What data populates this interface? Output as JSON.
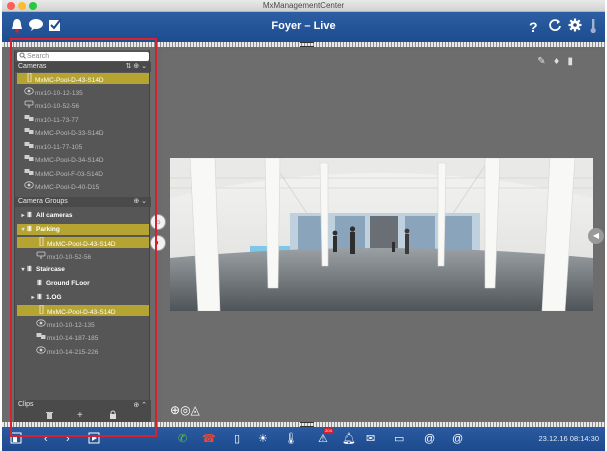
{
  "window": {
    "title": "MxManagementCenter"
  },
  "header": {
    "camera_title": "Foyer – Live",
    "help_icon": "?"
  },
  "sidebar": {
    "search_placeholder": "Search",
    "cameras_label": "Cameras",
    "cameras": [
      {
        "name": "MxMC-Pool-D-43-S14D",
        "icon": "pole-camera-icon",
        "selected": true
      },
      {
        "name": "mx10-10-12-135",
        "icon": "dome-camera-icon",
        "selected": false
      },
      {
        "name": "mx10-10-52-56",
        "icon": "bullet-camera-icon",
        "selected": false
      },
      {
        "name": "mx10-11-73-77",
        "icon": "dual-camera-icon",
        "selected": false
      },
      {
        "name": "MxMC-Pool-D-33-S14D",
        "icon": "dual-camera-icon",
        "selected": false
      },
      {
        "name": "mx10-11-77-105",
        "icon": "dual-camera-icon",
        "selected": false
      },
      {
        "name": "MxMC-Pool-D-34-S14D",
        "icon": "dual-camera-icon",
        "selected": false
      },
      {
        "name": "MxMC-Pool-F-03-S14D",
        "icon": "dual-camera-icon",
        "selected": false
      },
      {
        "name": "MxMC-Pool-D-40-D15",
        "icon": "dome-camera-icon",
        "selected": false
      }
    ],
    "groups_label": "Camera Groups",
    "groups": [
      {
        "name": "All cameras",
        "kind": "group",
        "level": 0,
        "arrow": "▸",
        "selected": false
      },
      {
        "name": "Parking",
        "kind": "group",
        "level": 0,
        "arrow": "▾",
        "selected": true
      },
      {
        "name": "MxMC-Pool-D-43-S14D",
        "kind": "camera",
        "icon": "pole-camera-icon",
        "level": 1,
        "selected": true
      },
      {
        "name": "mx10-10-52-56",
        "kind": "camera",
        "icon": "bullet-camera-icon",
        "level": 1,
        "selected": false
      },
      {
        "name": "Staircase",
        "kind": "group",
        "level": 0,
        "arrow": "▾",
        "selected": false
      },
      {
        "name": "Ground FLoor",
        "kind": "group",
        "level": 1,
        "arrow": "",
        "selected": false
      },
      {
        "name": "1.OG",
        "kind": "group",
        "level": 1,
        "arrow": "▸",
        "selected": false
      },
      {
        "name": "MxMC-Pool-D-43-S14D",
        "kind": "camera",
        "icon": "pole-camera-icon",
        "level": 1,
        "selected": true
      },
      {
        "name": "mx10-10-12-135",
        "kind": "camera",
        "icon": "dome-camera-icon",
        "level": 1,
        "selected": false
      },
      {
        "name": "mx10-14-187-185",
        "kind": "camera",
        "icon": "dual-camera-icon",
        "level": 1,
        "selected": false
      },
      {
        "name": "mx10-14-215-226",
        "kind": "camera",
        "icon": "dome-camera-icon",
        "level": 1,
        "selected": false
      }
    ],
    "clips_label": "Clips"
  },
  "statusbar": {
    "datetime": "23.12.16 08:14:30",
    "badge": "204",
    "at_symbol": "@"
  },
  "colors": {
    "accent_blue": "#2d5ea3",
    "selection_gold": "#b5a431",
    "highlight_red": "#d8202f"
  }
}
